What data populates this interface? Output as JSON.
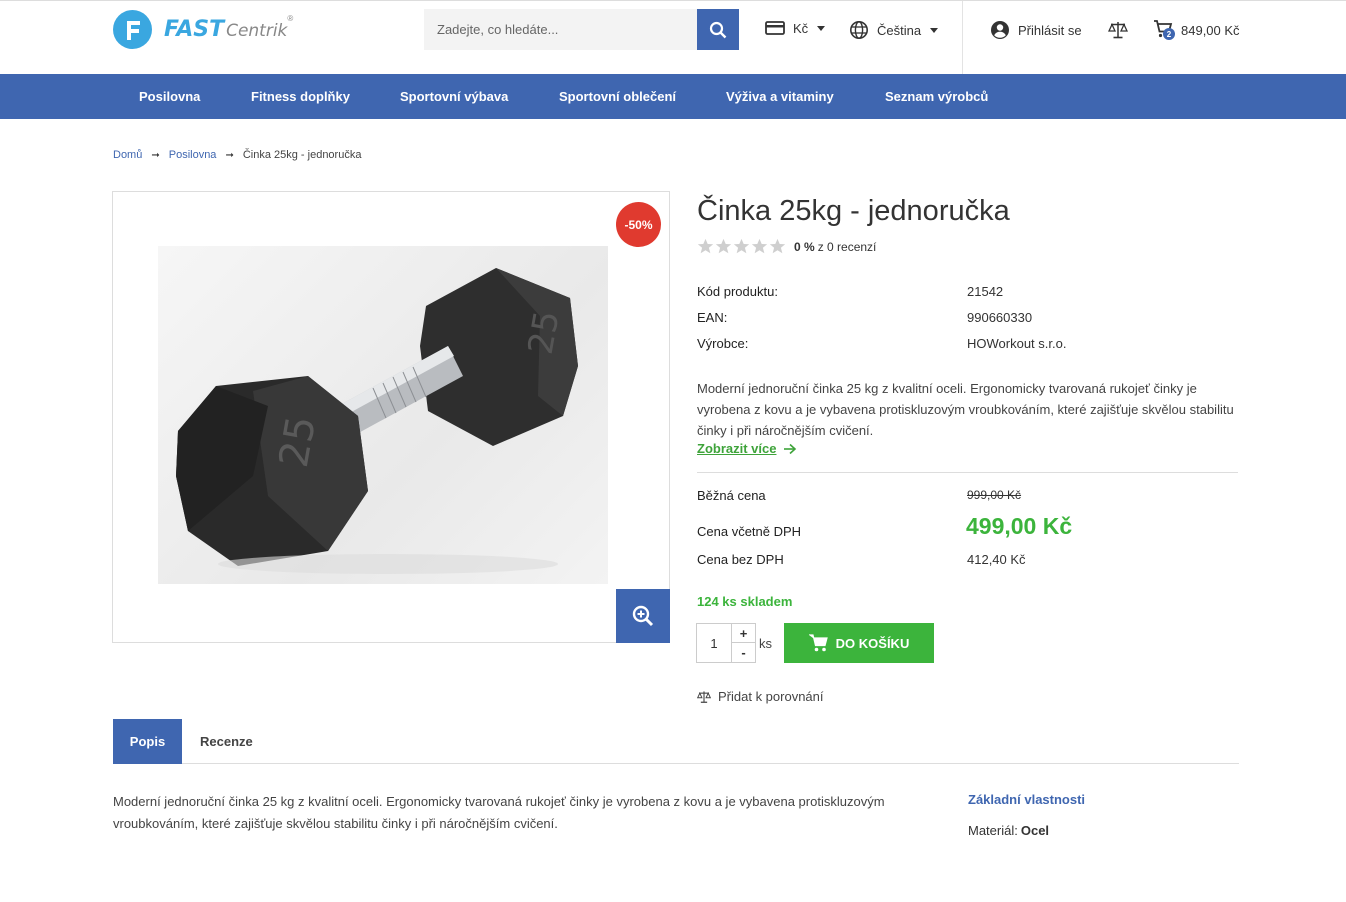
{
  "header": {
    "logo_main": "FAST",
    "logo_sub": "Centrik",
    "logo_reg": "®",
    "search_placeholder": "Zadejte, co hledáte...",
    "currency": "Kč",
    "language": "Čeština",
    "login": "Přihlásit se",
    "cart_count": "2",
    "cart_total": "849,00 Kč"
  },
  "nav": [
    "Posilovna",
    "Fitness doplňky",
    "Sportovní výbava",
    "Sportovní oblečení",
    "Výživa a vitaminy",
    "Seznam výrobců"
  ],
  "breadcrumb": {
    "home": "Domů",
    "category": "Posilovna",
    "current": "Činka 25kg - jednoručka",
    "separator": "➞"
  },
  "product": {
    "discount_badge": "-50%",
    "title": "Činka 25kg - jednoručka",
    "rating_percent": "0 %",
    "rating_text": "z 0 recenzí",
    "rating_value": 0,
    "specs": [
      {
        "label": "Kód produktu:",
        "value": "21542"
      },
      {
        "label": "EAN:",
        "value": "990660330"
      },
      {
        "label": "Výrobce:",
        "value": "HOWorkout s.r.o."
      }
    ],
    "short_description": "Moderní jednoruční činka 25 kg z kvalitní oceli. Ergonomicky tvarovaná rukojeť činky je vyrobena z kovu a je vybavena protiskluzovým vroubkováním, které zajišťuje skvělou stabilitu činky i při náročnějším cvičení.",
    "show_more": "Zobrazit více",
    "regular_price_label": "Běžná cena",
    "regular_price": "999,00 Kč",
    "price_vat_label": "Cena včetně DPH",
    "price_vat": "499,00 Kč",
    "price_net_label": "Cena bez DPH",
    "price_net": "412,40 Kč",
    "stock": "124 ks skladem",
    "quantity": "1",
    "qty_plus": "+",
    "qty_minus": "-",
    "unit": "ks",
    "add_to_cart": "DO KOŠÍKU",
    "compare": "Přidat k porovnání"
  },
  "tabs": [
    "Popis",
    "Recenze"
  ],
  "description": {
    "text": "Moderní jednoruční činka 25 kg z kvalitní oceli. Ergonomicky tvarovaná rukojeť činky je vyrobena z kovu a je vybavena protiskluzovým vroubkováním, které zajišťuje skvělou stabilitu činky i při náročnějším cvičení.",
    "properties_title": "Základní vlastnosti",
    "material_label": "Materiál:",
    "material_value": "Ocel"
  },
  "colors": {
    "primary": "#3f66b0",
    "logo": "#3aa7e0",
    "green": "#3cb43c",
    "discount": "#e03a2f"
  },
  "icons": [
    "search-icon",
    "card-icon",
    "globe-icon",
    "user-icon",
    "scale-icon",
    "cart-icon",
    "zoom-icon",
    "star-icon",
    "arrow-right-icon"
  ]
}
